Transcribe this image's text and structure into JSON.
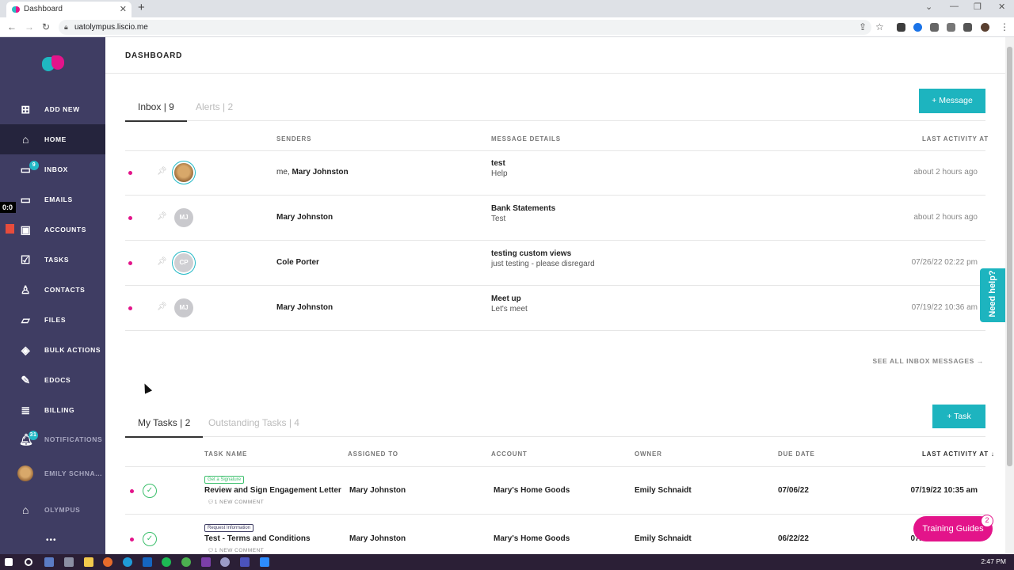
{
  "browser": {
    "tab_title": "Dashboard",
    "url": "uatolympus.liscio.me"
  },
  "sidebar": {
    "items": [
      {
        "label": "ADD NEW"
      },
      {
        "label": "HOME"
      },
      {
        "label": "INBOX",
        "badge": "9"
      },
      {
        "label": "EMAILS"
      },
      {
        "label": "ACCOUNTS"
      },
      {
        "label": "TASKS"
      },
      {
        "label": "CONTACTS"
      },
      {
        "label": "FILES"
      },
      {
        "label": "BULK ACTIONS"
      },
      {
        "label": "EDOCS"
      },
      {
        "label": "BILLING"
      },
      {
        "label": "NOTIFICATIONS",
        "badge": "31"
      },
      {
        "label": "EMILY SCHNA..."
      },
      {
        "label": "OLYMPUS"
      }
    ],
    "more": "•••",
    "left_marker": "0:0"
  },
  "header": {
    "title": "DASHBOARD"
  },
  "inbox": {
    "tabs": [
      "Inbox | 9",
      "Alerts | 2"
    ],
    "new_button": "+   Message",
    "columns": [
      "SENDERS",
      "MESSAGE DETAILS",
      "LAST ACTIVITY AT"
    ],
    "rows": [
      {
        "sender_prefix": "me, ",
        "sender": "Mary Johnston",
        "avatar": "",
        "subject": "test",
        "preview": "Help",
        "when": "about 2 hours ago"
      },
      {
        "sender_prefix": "",
        "sender": "Mary Johnston",
        "avatar": "MJ",
        "subject": "Bank Statements",
        "preview": "Test",
        "when": "about 2 hours ago"
      },
      {
        "sender_prefix": "",
        "sender": "Cole Porter",
        "avatar": "CP",
        "subject": "testing custom views",
        "preview": "just testing - please disregard",
        "when": "07/26/22 02:22 pm"
      },
      {
        "sender_prefix": "",
        "sender": "Mary Johnston",
        "avatar": "MJ",
        "subject": "Meet up",
        "preview": "Let's meet",
        "when": "07/19/22 10:36 am"
      }
    ],
    "see_all": "SEE ALL INBOX MESSAGES →"
  },
  "tasks": {
    "tabs": [
      "My Tasks | 2",
      "Outstanding Tasks | 4"
    ],
    "new_button": "+   Task",
    "columns": [
      "TASK NAME",
      "ASSIGNED TO",
      "ACCOUNT",
      "OWNER",
      "DUE DATE",
      "LAST ACTIVITY AT ↓"
    ],
    "rows": [
      {
        "tag": "Get a Signature",
        "name": "Review and Sign Engagement Letter",
        "comment": "1 NEW COMMENT",
        "assigned": "Mary Johnston",
        "account": "Mary's Home Goods",
        "owner": "Emily Schnaidt",
        "due": "07/06/22",
        "last": "07/19/22 10:35 am"
      },
      {
        "tag": "Request Information",
        "name": "Test - Terms and Conditions",
        "comment": "1 NEW COMMENT",
        "assigned": "Mary Johnston",
        "account": "Mary's Home Goods",
        "owner": "Emily Schnaidt",
        "due": "06/22/22",
        "last": "07/19/22 10:24 am"
      }
    ]
  },
  "widgets": {
    "need_help": "Need help?",
    "training": "Training Guides",
    "training_badge": "2"
  },
  "taskbar": {
    "time": "2:47 PM"
  },
  "colors": {
    "sidebar": "#3f3d63",
    "accent": "#1db4bf",
    "brand_pink": "#e3148a"
  }
}
